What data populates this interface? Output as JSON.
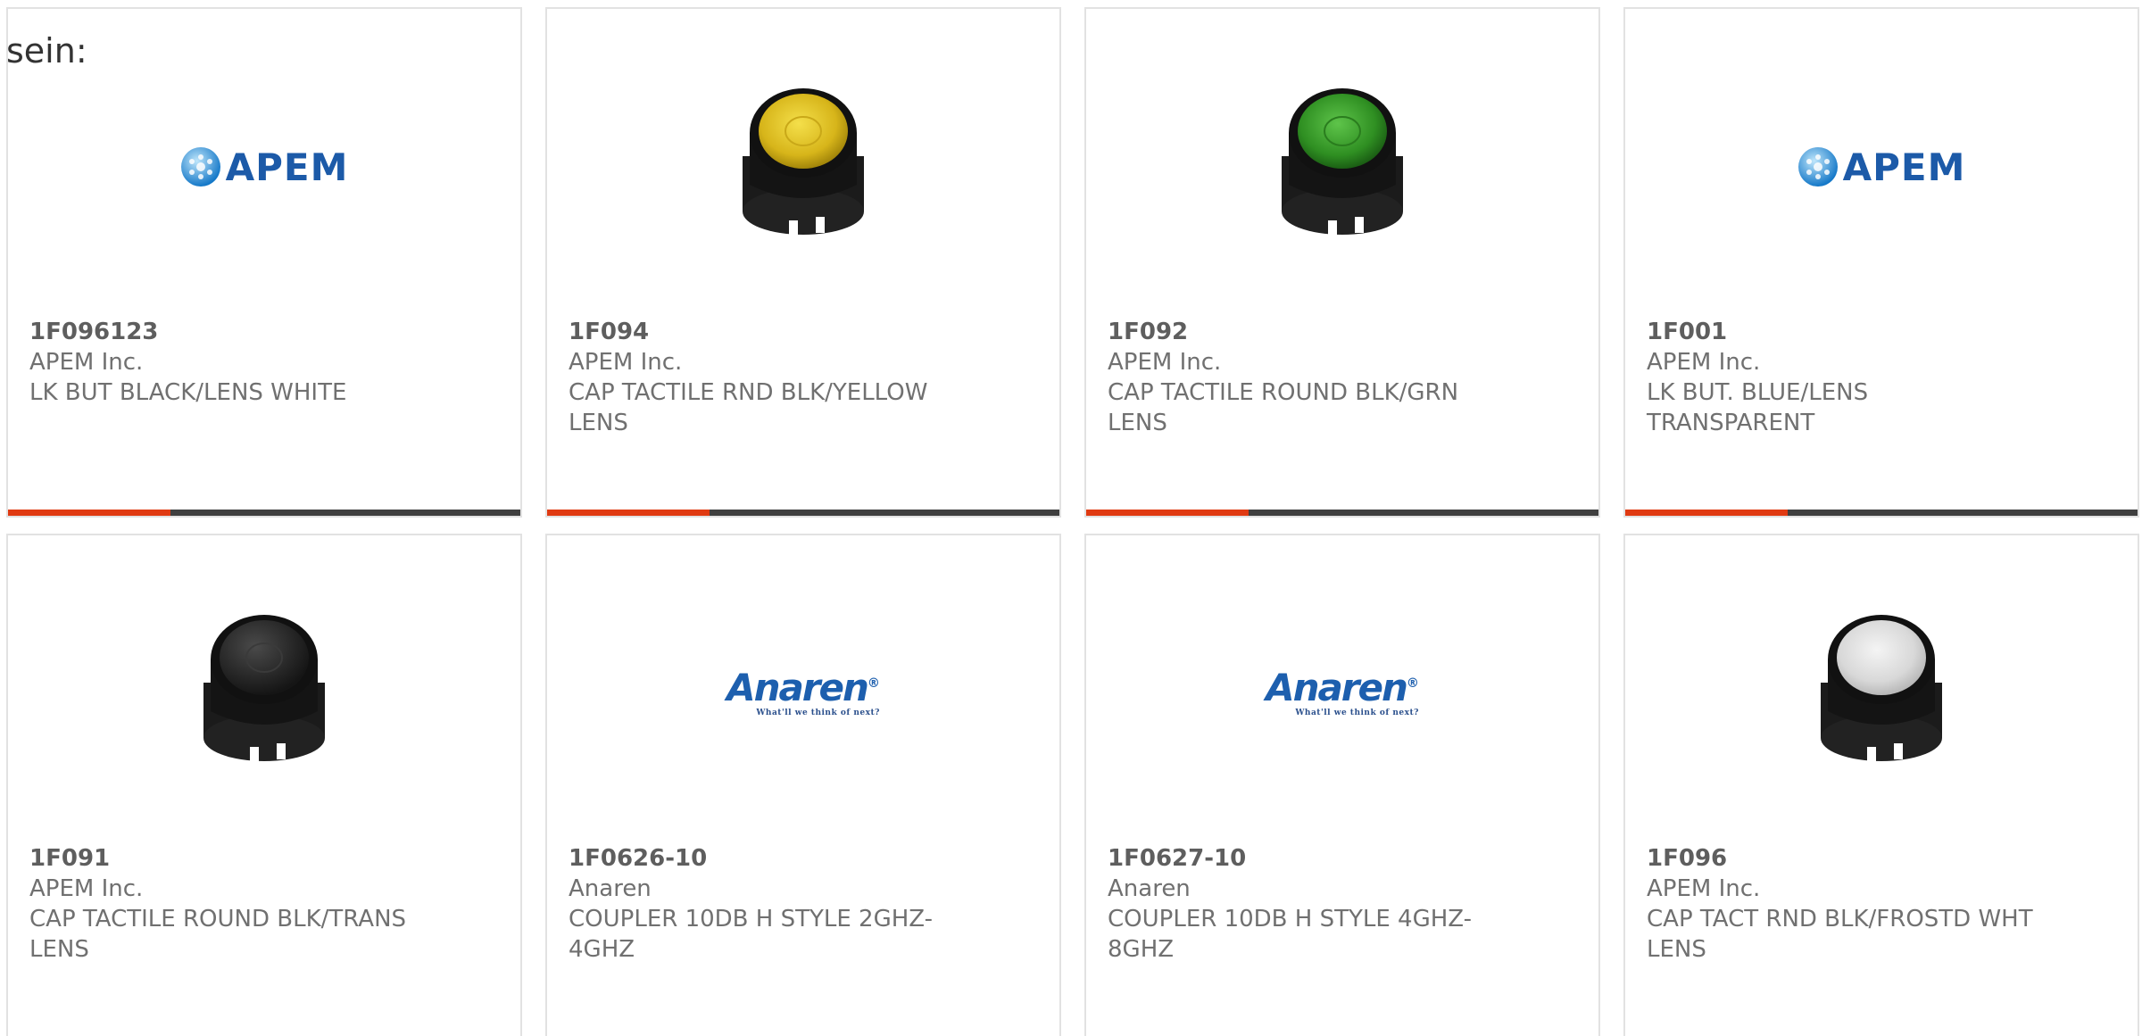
{
  "intro_text": "sein:",
  "colors": {
    "accent": "#e03a12",
    "bar": "#3f3f3f",
    "card_border": "#e2e2e2"
  },
  "products": [
    {
      "part_number": "1F096123",
      "manufacturer": "APEM Inc.",
      "description": "LK BUT BLACK/LENS WHITE",
      "image": "apem-logo"
    },
    {
      "part_number": "1F094",
      "manufacturer": "APEM Inc.",
      "description": "CAP TACTILE RND BLK/YELLOW LENS",
      "image": "cap-yellow-lens"
    },
    {
      "part_number": "1F092",
      "manufacturer": "APEM Inc.",
      "description": "CAP TACTILE ROUND BLK/GRN LENS",
      "image": "cap-green-lens"
    },
    {
      "part_number": "1F001",
      "manufacturer": "APEM Inc.",
      "description": "LK BUT. BLUE/LENS TRANSPARENT",
      "image": "apem-logo"
    },
    {
      "part_number": "1F091",
      "manufacturer": "APEM Inc.",
      "description": "CAP TACTILE ROUND BLK/TRANS LENS",
      "image": "cap-transparent-lens"
    },
    {
      "part_number": "1F0626-10",
      "manufacturer": "Anaren",
      "description": "COUPLER 10DB H STYLE 2GHZ-4GHZ",
      "image": "anaren-logo"
    },
    {
      "part_number": "1F0627-10",
      "manufacturer": "Anaren",
      "description": "COUPLER 10DB H STYLE 4GHZ-8GHZ",
      "image": "anaren-logo"
    },
    {
      "part_number": "1F096",
      "manufacturer": "APEM Inc.",
      "description": "CAP TACT RND BLK/FROSTD WHT LENS",
      "image": "cap-white-lens"
    }
  ],
  "logos": {
    "apem": "APEM",
    "anaren": "Anaren",
    "anaren_reg": "®",
    "anaren_tagline": "What'll we think of next?"
  }
}
